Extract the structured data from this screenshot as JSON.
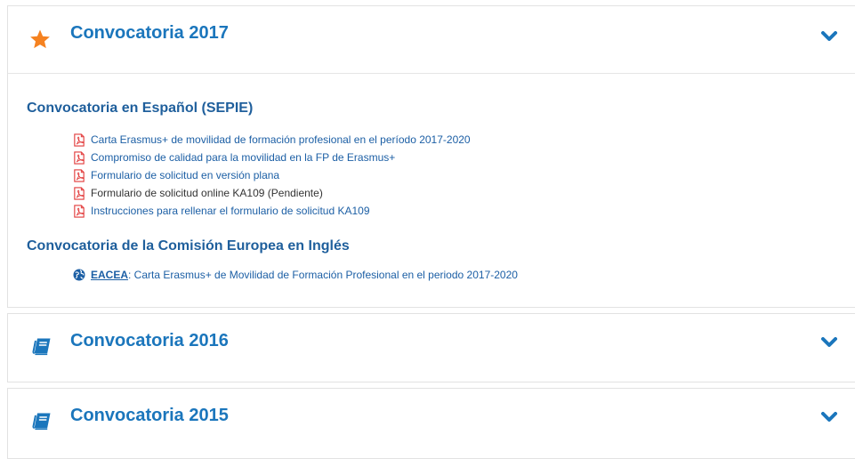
{
  "colors": {
    "accent": "#1b76bc",
    "star": "#f58220",
    "pdf": "#e23b3b",
    "link": "#1c5fa5"
  },
  "panels": [
    {
      "title": "Convocatoria 2017",
      "icon": "star-icon",
      "expanded": true,
      "sections": [
        {
          "title": "Convocatoria en Español (SEPIE)",
          "items": [
            "Carta Erasmus+ de movilidad de formación profesional en el período 2017-2020",
            "Compromiso de calidad para la movilidad en la FP de Erasmus+",
            "Formulario de solicitud en versión plana",
            "Formulario de solicitud online KA109 (Pendiente)",
            "Instrucciones para rellenar el formulario de solicitud KA109"
          ]
        },
        {
          "title": "Convocatoria de la Comisión Europea en Inglés",
          "link_abbr": "EACEA",
          "link_rest": ": Carta Erasmus+ de Movilidad de Formación Profesional en el periodo 2017-2020"
        }
      ]
    },
    {
      "title": "Convocatoria 2016",
      "icon": "book-icon",
      "expanded": false
    },
    {
      "title": "Convocatoria 2015",
      "icon": "book-icon",
      "expanded": false
    }
  ]
}
